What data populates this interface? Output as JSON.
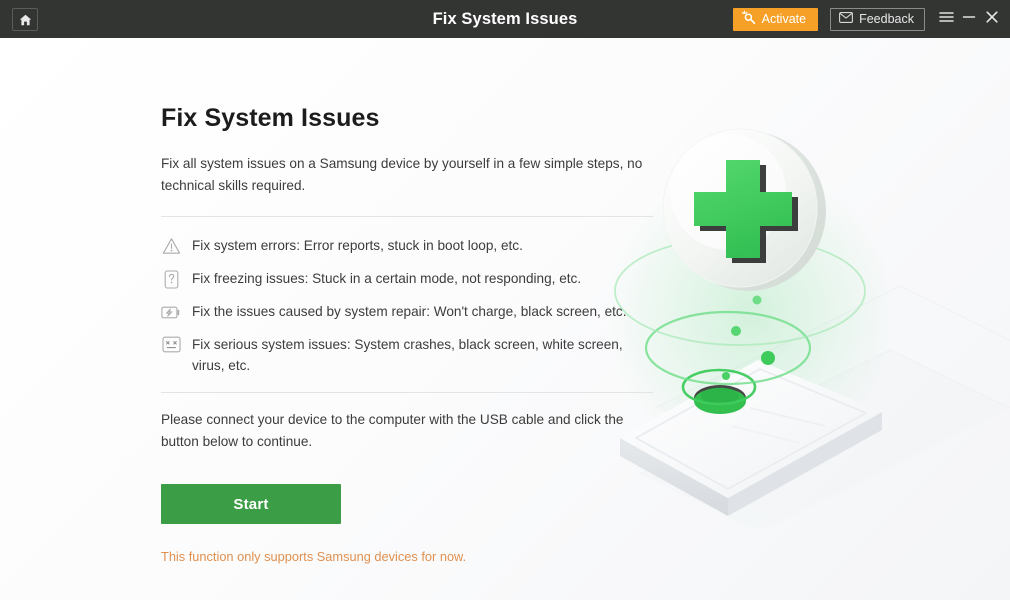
{
  "titlebar": {
    "home_icon": "home-icon",
    "title": "Fix System Issues",
    "activate_label": "Activate",
    "activate_icon": "key-sparkle-icon",
    "activate_color": "#f6a028",
    "feedback_label": "Feedback",
    "feedback_icon": "envelope-icon",
    "menu_icon": "hamburger-menu-icon",
    "minimize_icon": "minimize-icon",
    "close_icon": "close-icon",
    "background_color": "#333533"
  },
  "main": {
    "heading": "Fix System Issues",
    "lead": "Fix all system issues on a Samsung device by yourself in a few simple steps, no technical skills required.",
    "features": [
      {
        "icon": "warning-triangle-icon",
        "text": "Fix system errors: Error reports, stuck in boot loop, etc."
      },
      {
        "icon": "phone-question-icon",
        "text": "Fix freezing issues: Stuck in a certain mode, not responding, etc."
      },
      {
        "icon": "battery-charging-icon",
        "text": "Fix the issues caused by system repair: Won't charge, black screen, etc."
      },
      {
        "icon": "crashed-screen-icon",
        "text": "Fix serious system issues: System crashes, black screen, white screen, virus, etc."
      }
    ],
    "connect_note": "Please connect your device to the computer with the USB cable and click the button below to continue.",
    "start_label": "Start",
    "start_color": "#3b9e46",
    "support_note": "This function only supports Samsung devices for now.",
    "support_note_color": "#e0904f"
  },
  "illustration": {
    "name": "phone-repair-illustration",
    "accent_green": "#3ecb5c",
    "description": "White disc with green plus sign floating above an isometric white phone with green rings"
  }
}
